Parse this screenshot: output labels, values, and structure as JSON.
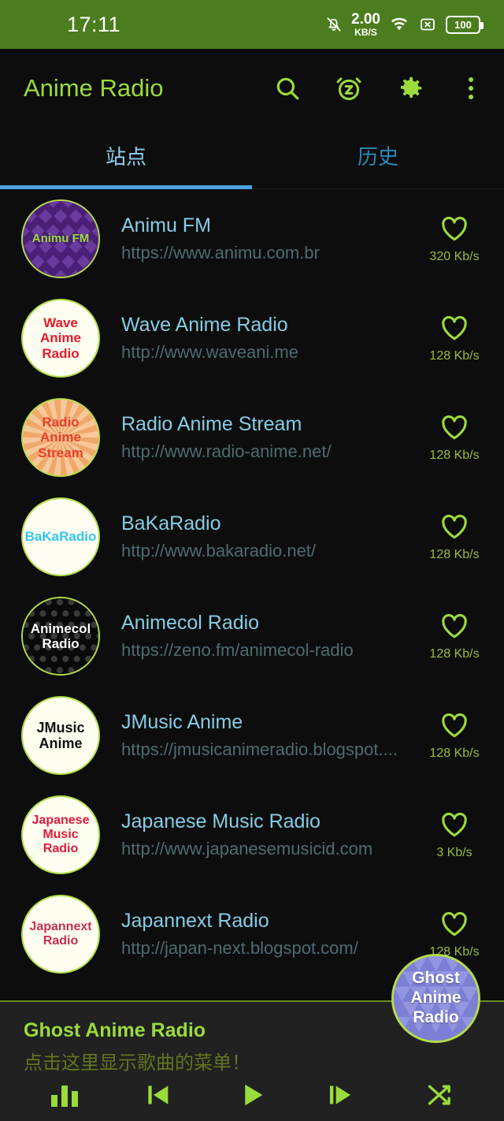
{
  "statusbar": {
    "time": "17:11",
    "net_speed_value": "2.00",
    "net_speed_unit": "KB/S",
    "battery_level": "100",
    "icons": [
      "notifications-off-icon",
      "wifi-icon",
      "sim-off-icon",
      "battery-icon"
    ]
  },
  "appbar": {
    "title": "Anime Radio",
    "actions": [
      "search-icon",
      "sleep-timer-icon",
      "settings-gear-icon",
      "overflow-menu-icon"
    ]
  },
  "tabs": {
    "items": [
      {
        "label": "站点",
        "active": true
      },
      {
        "label": "历史",
        "active": false
      }
    ]
  },
  "stations": [
    {
      "name": "Animu FM",
      "url": "https://www.animu.com.br",
      "bitrate": "320 Kb/s",
      "avatar_text": [
        "Animu FM"
      ],
      "avatar_bg": "#4a1f78",
      "avatar_text_color": "#9bdb3b",
      "avatar_pattern": "diamonds",
      "avatar_font_size": 15,
      "favorite": false
    },
    {
      "name": "Wave Anime Radio",
      "url": "http://www.waveani.me",
      "bitrate": "128 Kb/s",
      "avatar_text": [
        "Wave",
        "Anime",
        "Radio"
      ],
      "avatar_bg": "#fdfdf0",
      "avatar_text_color": "#e8192c",
      "avatar_pattern": "none",
      "avatar_font_size": 17,
      "favorite": false
    },
    {
      "name": "Radio Anime Stream",
      "url": "http://www.radio-anime.net/",
      "bitrate": "128 Kb/s",
      "avatar_text": [
        "Radio",
        "Anime",
        "Stream"
      ],
      "avatar_bg": "#f7c89a",
      "avatar_text_color": "#e8402c",
      "avatar_pattern": "rays",
      "avatar_font_size": 17,
      "favorite": false
    },
    {
      "name": "BaKaRadio",
      "url": "http://www.bakaradio.net/",
      "bitrate": "128 Kb/s",
      "avatar_text": [
        "BaKaRadio"
      ],
      "avatar_bg": "#fdfdf2",
      "avatar_text_color": "#37c6f0",
      "avatar_pattern": "none",
      "avatar_font_size": 17,
      "favorite": false
    },
    {
      "name": "Animecol Radio",
      "url": "https://zeno.fm/animecol-radio",
      "bitrate": "128 Kb/s",
      "avatar_text": [
        "Animecol",
        "Radio"
      ],
      "avatar_bg": "#0a0a0a",
      "avatar_text_color": "#ffffff",
      "avatar_pattern": "dots",
      "avatar_font_size": 17,
      "favorite": false
    },
    {
      "name": "JMusic Anime",
      "url": "https://jmusicanimeradio.blogspot....",
      "bitrate": "128 Kb/s",
      "avatar_text": [
        "JMusic",
        "Anime"
      ],
      "avatar_bg": "#fdfdf0",
      "avatar_text_color": "#111111",
      "avatar_pattern": "none",
      "avatar_font_size": 18,
      "favorite": false
    },
    {
      "name": "Japanese Music Radio",
      "url": "http://www.japanesemusicid.com",
      "bitrate": "3 Kb/s",
      "avatar_text": [
        "Japanese",
        "Music",
        "Radio"
      ],
      "avatar_bg": "#fdfdf0",
      "avatar_text_color": "#e01b3c",
      "avatar_font_size": 16,
      "avatar_pattern": "none",
      "favorite": false
    },
    {
      "name": "Japannext Radio",
      "url": "http://japan-next.blogspot.com/",
      "bitrate": "128 Kb/s",
      "avatar_text": [
        "Japannext",
        "Radio"
      ],
      "avatar_bg": "#fdfdf0",
      "avatar_text_color": "#c9304f",
      "avatar_pattern": "none",
      "avatar_font_size": 16,
      "favorite": false
    }
  ],
  "now_playing": {
    "title": "Ghost Anime Radio",
    "subtitle": "点击这里显示歌曲的菜单！",
    "avatar_text": [
      "Ghost",
      "Anime",
      "Radio"
    ],
    "avatar_bg": "#7c7fd4"
  },
  "player_controls": [
    {
      "name": "equalizer-icon"
    },
    {
      "name": "previous-track-icon"
    },
    {
      "name": "play-icon"
    },
    {
      "name": "next-track-icon"
    },
    {
      "name": "shuffle-icon"
    }
  ],
  "colors": {
    "accent_green": "#9bdb3b",
    "status_bar_green": "#4b7d1e",
    "tab_active_blue": "#8fd0f0",
    "tab_inactive_blue": "#2b88b8",
    "tab_indicator": "#4aa3df",
    "station_name": "#86cde6",
    "station_url": "#4e6b72",
    "background": "#0d0d0d",
    "player_bg": "#212121"
  }
}
